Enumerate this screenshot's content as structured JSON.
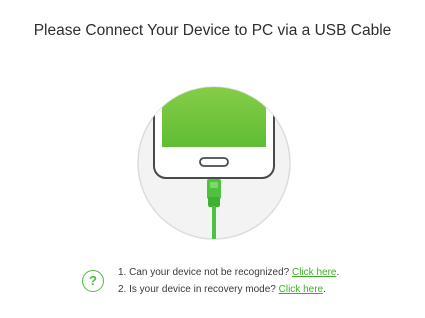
{
  "title": "Please Connect Your Device to PC via a USB Cable",
  "illustration": {
    "icon": "phone-usb-connect-icon",
    "colors": {
      "screen": "#6cc43a",
      "cable": "#4cc23d",
      "circle": "#ececec"
    }
  },
  "help": {
    "icon": "question-circle-icon",
    "items": [
      {
        "number": "1.",
        "text": "Can your device not be recognized?",
        "link": "Click here",
        "suffix": "."
      },
      {
        "number": "2.",
        "text": "Is your device in recovery mode?",
        "link": "Click here",
        "suffix": "."
      }
    ]
  }
}
